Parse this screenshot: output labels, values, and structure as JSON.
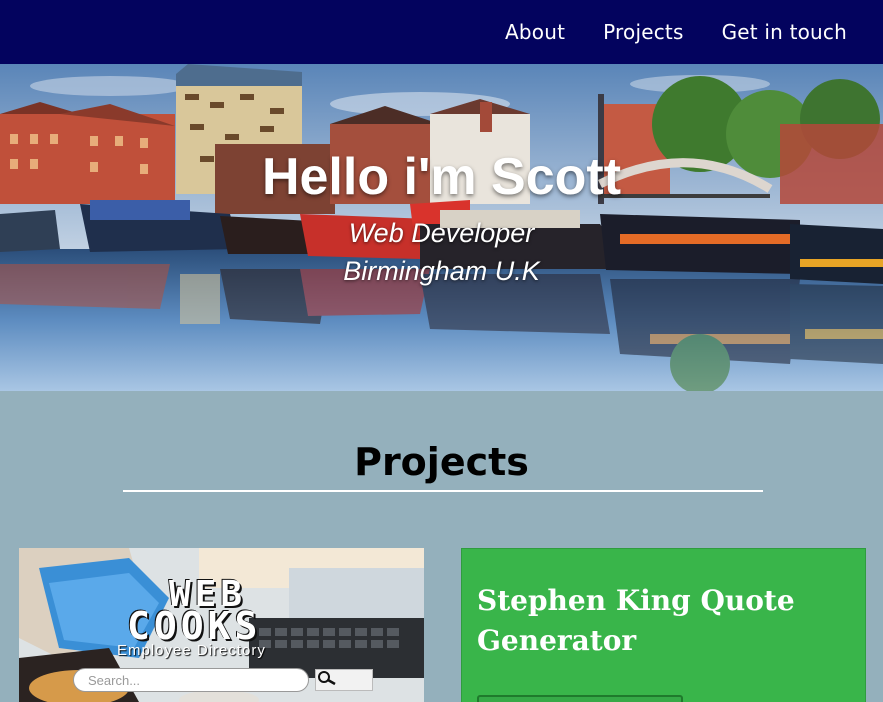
{
  "nav": {
    "items": [
      {
        "label": "About"
      },
      {
        "label": "Projects"
      },
      {
        "label": "Get in touch"
      }
    ]
  },
  "hero": {
    "title": "Hello i'm Scott",
    "role": "Web Developer",
    "location": "Birmingham U.K"
  },
  "projects": {
    "heading": "Projects",
    "cards": [
      {
        "logo_line1": "WEB",
        "logo_line2": "COOKS",
        "logo_subtitle": "Employee Directory",
        "search_placeholder": "Search...",
        "search_icon": "magnifier-icon"
      },
      {
        "title": "Stephen King Quote Generator",
        "accent": "#39b54a"
      }
    ]
  },
  "colors": {
    "navbar": "#03035e",
    "page_background": "#94b0bc",
    "card_green": "#39b54a"
  }
}
